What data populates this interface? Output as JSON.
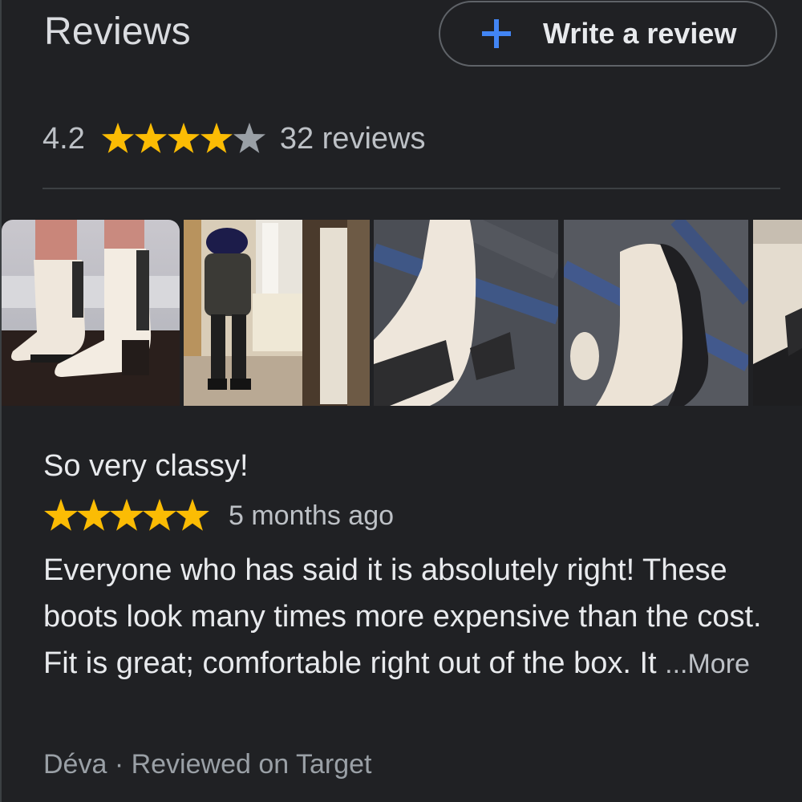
{
  "header": {
    "title": "Reviews",
    "write_review_label": "Write a review",
    "write_review_icon": "plus-icon",
    "accent_color": "#4285f4"
  },
  "summary": {
    "average": "4.2",
    "rating_value": 4.2,
    "rating_max": 5,
    "count_label": "32 reviews",
    "star_color": "#fbbc04",
    "empty_star_color": "#9aa0a6"
  },
  "photos": [
    {
      "name": "review-photo-boots-standing"
    },
    {
      "name": "review-photo-mirror-selfie"
    },
    {
      "name": "review-photo-boot-closeup-1"
    },
    {
      "name": "review-photo-boot-closeup-2"
    },
    {
      "name": "review-photo-boot-partial"
    }
  ],
  "review": {
    "title": "So very classy!",
    "rating": 5,
    "time": "5 months ago",
    "body": "Everyone who has said it is absolutely right! These boots look many times more expensive than the cost. Fit is great; comfortable right out of the box. It ",
    "more_label": "...More",
    "author": "Déva",
    "separator": " · ",
    "source": "Reviewed on Target"
  }
}
